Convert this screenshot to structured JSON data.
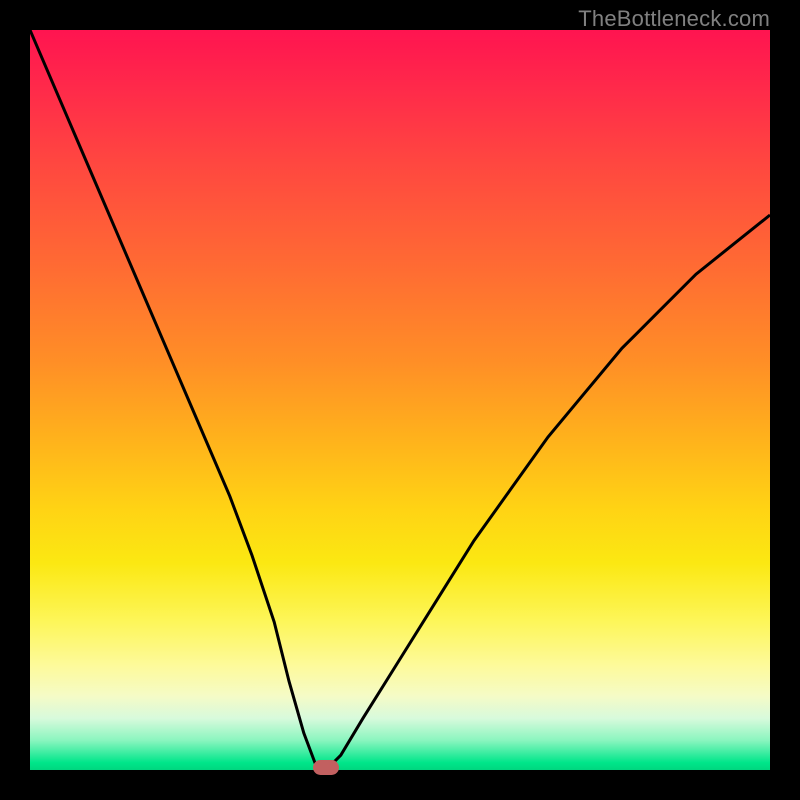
{
  "watermark": "TheBottleneck.com",
  "chart_data": {
    "type": "line",
    "title": "",
    "xlabel": "",
    "ylabel": "",
    "xlim": [
      0,
      100
    ],
    "ylim": [
      0,
      100
    ],
    "grid": false,
    "legend": false,
    "background_gradient": {
      "top": "#ff1450",
      "middle": "#ffd414",
      "bottom": "#00d67f"
    },
    "series": [
      {
        "name": "bottleneck-curve",
        "color": "#000000",
        "x": [
          0,
          3,
          6,
          9,
          12,
          15,
          18,
          21,
          24,
          27,
          30,
          33,
          35,
          37,
          38.5,
          40,
          42,
          45,
          50,
          55,
          60,
          65,
          70,
          75,
          80,
          85,
          90,
          95,
          100
        ],
        "values": [
          100,
          93,
          86,
          79,
          72,
          65,
          58,
          51,
          44,
          37,
          29,
          20,
          12,
          5,
          1,
          0,
          2,
          7,
          15,
          23,
          31,
          38,
          45,
          51,
          57,
          62,
          67,
          71,
          75
        ]
      }
    ],
    "marker": {
      "name": "current-point",
      "color": "#c26060",
      "x": 40,
      "y": 0
    }
  },
  "colors": {
    "frame": "#000000",
    "watermark": "#808080"
  }
}
